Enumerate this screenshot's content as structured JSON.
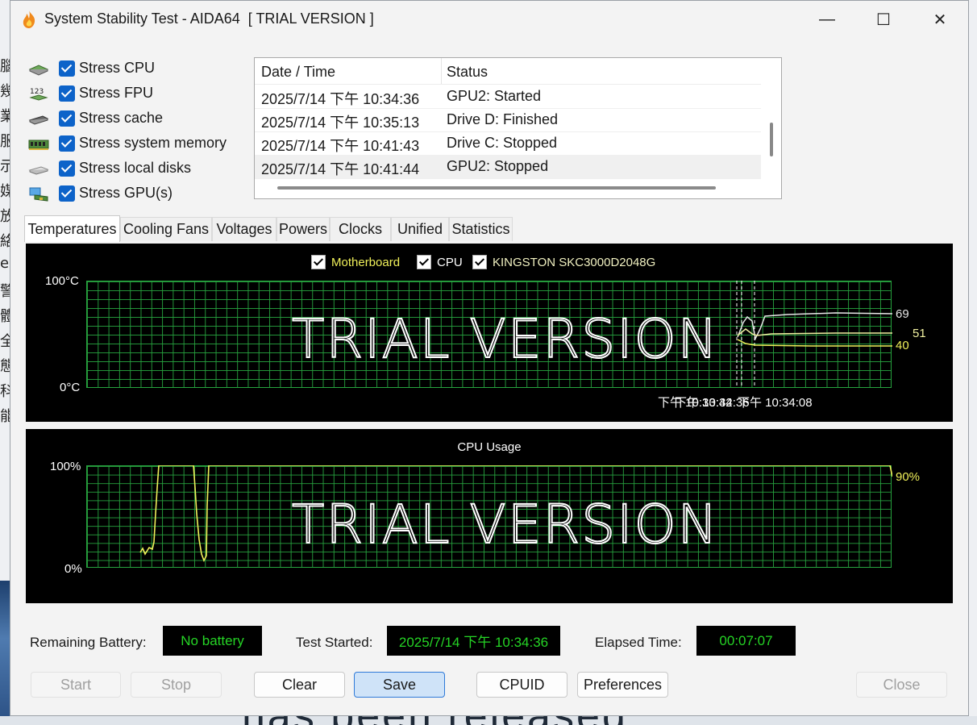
{
  "window": {
    "title": "System Stability Test - AIDA64  [ TRIAL VERSION ]",
    "minimize_glyph": "—",
    "maximize_glyph": "☐",
    "close_glyph": "✕"
  },
  "desktop": {
    "left_glyphs": [
      "腦",
      "幾",
      "業",
      "服",
      "示",
      "媒",
      "放",
      "絡",
      "ec",
      "警",
      "體",
      "全",
      "態",
      "科",
      "能"
    ],
    "bottom_text": "has been released"
  },
  "stress_options": [
    {
      "label": "Stress CPU",
      "checked": true,
      "icon": "cpu-chip-icon"
    },
    {
      "label": "Stress FPU",
      "checked": true,
      "icon": "fpu-icon"
    },
    {
      "label": "Stress cache",
      "checked": true,
      "icon": "cache-icon"
    },
    {
      "label": "Stress system memory",
      "checked": true,
      "icon": "memory-icon"
    },
    {
      "label": "Stress local disks",
      "checked": true,
      "icon": "disk-icon"
    },
    {
      "label": "Stress GPU(s)",
      "checked": true,
      "icon": "gpu-icon"
    }
  ],
  "log": {
    "headers": [
      "Date / Time",
      "Status"
    ],
    "rows": [
      {
        "time": "2025/7/14 下午 10:34:36",
        "status": "GPU2: Started"
      },
      {
        "time": "2025/7/14 下午 10:35:13",
        "status": "Drive D: Finished"
      },
      {
        "time": "2025/7/14 下午 10:41:43",
        "status": "Drive C: Stopped"
      },
      {
        "time": "2025/7/14 下午 10:41:44",
        "status": "GPU2: Stopped"
      }
    ]
  },
  "tabs": [
    "Temperatures",
    "Cooling Fans",
    "Voltages",
    "Powers",
    "Clocks",
    "Unified",
    "Statistics"
  ],
  "active_tab": "Temperatures",
  "temperature_graph": {
    "legend": [
      {
        "label": "Motherboard",
        "color": "#f0f05a"
      },
      {
        "label": "CPU",
        "color": "#ffffff"
      },
      {
        "label": "KINGSTON SKC3000D2048G",
        "color": "#f0f0c0"
      }
    ],
    "y_max_label": "100°C",
    "y_min_label": "0°C",
    "watermark": "TRIAL VERSION",
    "time_labels": [
      "下午 10:33:42",
      "下午 10:34:36",
      "下午 10:34:08"
    ],
    "current_values": [
      {
        "value": "69",
        "color": "#e6e6e6"
      },
      {
        "value": "51",
        "color": "#f0f0a0"
      },
      {
        "value": "40",
        "color": "#f0f05a"
      }
    ]
  },
  "cpu_graph": {
    "title": "CPU Usage",
    "y_max_label": "100%",
    "y_min_label": "0%",
    "watermark": "TRIAL VERSION",
    "current_value": "90%",
    "line_color": "#f0f05a"
  },
  "status_bar": {
    "battery_label": "Remaining Battery:",
    "battery_value": "No battery",
    "started_label": "Test Started:",
    "started_value": "2025/7/14 下午 10:34:36",
    "elapsed_label": "Elapsed Time:",
    "elapsed_value": "00:07:07"
  },
  "buttons": {
    "start": "Start",
    "stop": "Stop",
    "clear": "Clear",
    "save": "Save",
    "cpuid": "CPUID",
    "preferences": "Preferences",
    "close": "Close"
  },
  "colors": {
    "grid": "#27a33f",
    "readout_text": "#25d425",
    "checkbox": "#0d63c9"
  }
}
